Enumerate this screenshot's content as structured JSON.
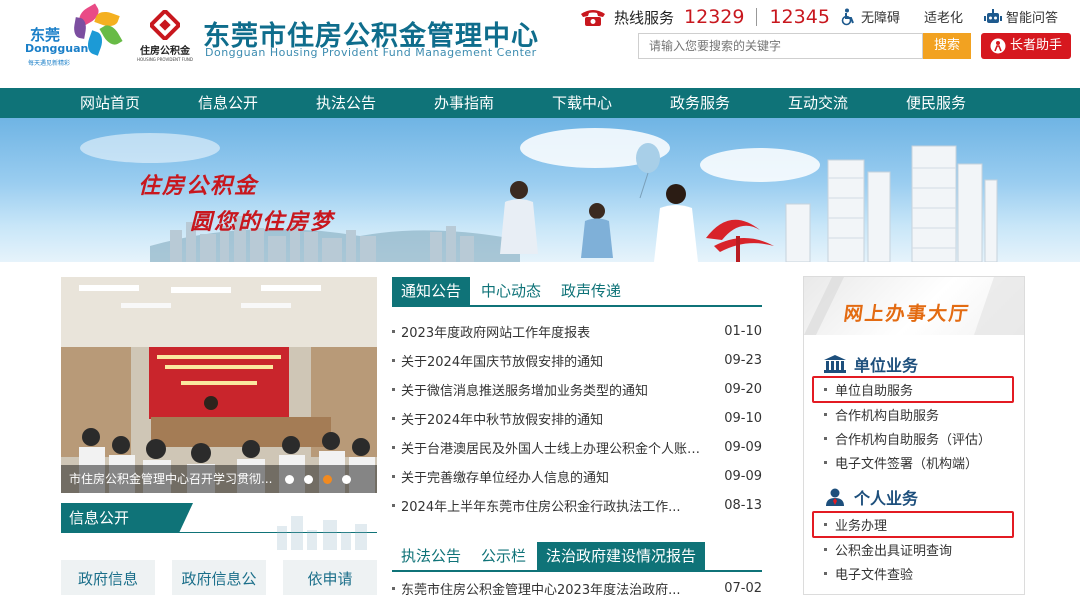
{
  "header": {
    "city_logo": {
      "name_cn": "东莞",
      "name_en": "Dongguan",
      "slogan": "每天遇见新精彩"
    },
    "fund_logo": {
      "name_cn": "住房公积金",
      "name_en": "HOUSING PROVIDENT FUND"
    },
    "title": "东莞市住房公积金管理中心",
    "subtitle": "Dongguan Housing Provident Fund Management Center",
    "hotline_label": "热线服务",
    "hotline_numbers": [
      "12329",
      "12345"
    ],
    "accessible_label": "无障碍",
    "elderly_mode_label": "适老化",
    "smart_qa_label": "智能问答",
    "search": {
      "placeholder": "请输入您要搜索的关键字",
      "button_label": "搜索"
    },
    "elder_assistant_label": "长者助手"
  },
  "nav": {
    "items": [
      {
        "label": "网站首页"
      },
      {
        "label": "信息公开"
      },
      {
        "label": "执法公告"
      },
      {
        "label": "办事指南"
      },
      {
        "label": "下载中心"
      },
      {
        "label": "政务服务"
      },
      {
        "label": "互动交流"
      },
      {
        "label": "便民服务"
      }
    ]
  },
  "banner": {
    "slogan_line1": "住房公积金",
    "slogan_line2": "圆您的住房梦"
  },
  "slider": {
    "caption": "市住房公积金管理中心召开学习贯彻...",
    "slide_count": 4,
    "active_index": 2
  },
  "info_public": {
    "tab_label": "信息公开",
    "buttons": [
      {
        "label": "政府信息"
      },
      {
        "label": "政府信息公"
      },
      {
        "label": "依申请"
      }
    ]
  },
  "news": {
    "tabs": [
      {
        "label": "通知公告",
        "active": true
      },
      {
        "label": "中心动态",
        "active": false
      },
      {
        "label": "政声传递",
        "active": false
      }
    ],
    "items": [
      {
        "title": "2023年度政府网站工作年度报表",
        "date": "01-10"
      },
      {
        "title": "关于2024年国庆节放假安排的通知",
        "date": "09-23"
      },
      {
        "title": "关于微信消息推送服务增加业务类型的通知",
        "date": "09-20"
      },
      {
        "title": "关于2024年中秋节放假安排的通知",
        "date": "09-10"
      },
      {
        "title": "关于台港澳居民及外国人士线上办理公积金个人账户...",
        "date": "09-09"
      },
      {
        "title": "关于完善缴存单位经办人信息的通知",
        "date": "09-09"
      },
      {
        "title": "2024年上半年东莞市住房公积金行政执法工作...",
        "date": "08-13"
      }
    ]
  },
  "law": {
    "tabs": [
      {
        "label": "执法公告",
        "active": false
      },
      {
        "label": "公示栏",
        "active": false
      },
      {
        "label": "法治政府建设情况报告",
        "active": true
      }
    ],
    "items": [
      {
        "title": "东莞市住房公积金管理中心2023年度法治政府...",
        "date": "07-02"
      }
    ]
  },
  "service_hall": {
    "title": "网上办事大厅",
    "unit_section": {
      "label": "单位业务",
      "links": [
        "单位自助服务",
        "合作机构自助服务",
        "合作机构自助服务（评估）",
        "电子文件签署（机构端）"
      ]
    },
    "personal_section": {
      "label": "个人业务",
      "links": [
        "业务办理",
        "公积金出具证明查询",
        "电子文件查验"
      ]
    }
  },
  "colors": {
    "nav_teal": "#0f7378",
    "title_blue": "#0f6d8c",
    "hotline_red": "#c8171e",
    "search_orange": "#f2a221",
    "elder_red": "#d6181f",
    "hall_orange": "#e36b12",
    "highlight_red": "#e31b23"
  }
}
